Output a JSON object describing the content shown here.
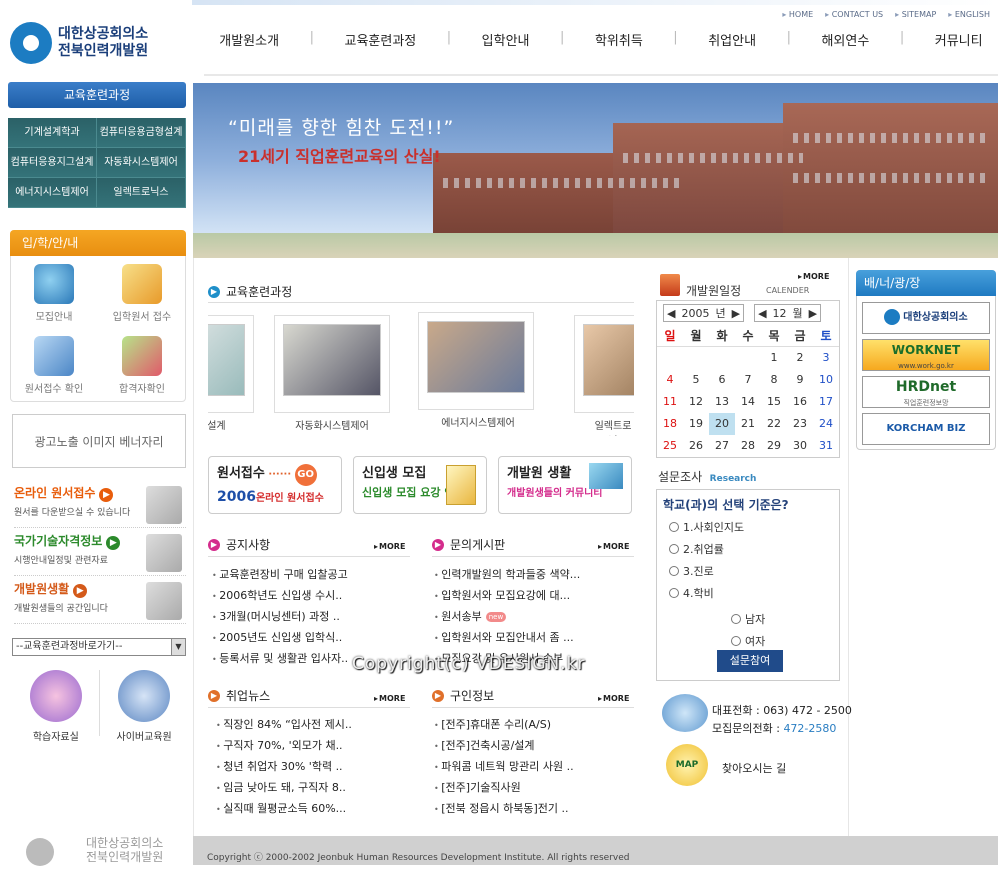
{
  "header": {
    "logo_line1": "대한상공회의소",
    "logo_line2": "전북인력개발원",
    "util_nav": [
      "HOME",
      "CONTACT US",
      "SITEMAP",
      "ENGLISH"
    ],
    "main_nav": [
      "개발원소개",
      "교육훈련과정",
      "입학안내",
      "학위취득",
      "취업안내",
      "해외연수",
      "커뮤니티"
    ]
  },
  "hero": {
    "line1": "“미래를 향한 힘찬 도전!!”",
    "line2": "21세기 직업훈련교육의 산실!"
  },
  "left": {
    "course_head": "교육훈련과정",
    "courses": [
      "기계설계학과",
      "컴퓨터응용금형설계",
      "컴퓨터응용지그설계",
      "자동화시스템제어",
      "에너지시스템제어",
      "일렉트로닉스"
    ],
    "admission_head": "입/학/안/내",
    "admission_items": [
      "모집안내",
      "입학원서 접수",
      "원서접수 확인",
      "합격자확인"
    ],
    "ad_banner": "광고노출 이미지 베너자리",
    "links": [
      {
        "title": "온라인 원서접수",
        "sub": "원서를 다운받으실 수 있습니다",
        "color": "#e85d0c"
      },
      {
        "title": "국가기술자격정보",
        "sub": "시행안내일정및 관련자료",
        "color": "#2c8a2c"
      },
      {
        "title": "개발원생활",
        "sub": "개발원생들의 공간입니다",
        "color": "#d45a1a"
      }
    ],
    "quick_select": "--교육훈련과정바로가기--",
    "circle_buttons": [
      "학습자료실",
      "사이버교육원"
    ],
    "footer_logo_line1": "대한상공회의소",
    "footer_logo_line2": "전북인력개발원"
  },
  "courses_section": {
    "title": "교육훈련과정",
    "photos": [
      "그설계",
      "자동화시스템제어",
      "에너지시스템제어",
      "일렉트로닉"
    ]
  },
  "banners": [
    {
      "t1": "원서접수",
      "go": "GO",
      "t2a": "2006",
      "t2b": "온라인 원서접수"
    },
    {
      "t1": "신입생 모집",
      "t2": "신입생 모집 요강 안내"
    },
    {
      "t1": "개발원 생활",
      "t2": "개발원생들의 커뮤니티"
    }
  ],
  "notice": {
    "title": "공지사항",
    "more": "MORE",
    "items": [
      "교육훈련장비 구매 입찰공고",
      "2006학년도 신입생 수시..",
      "3개월(머시닝센터) 과정 ..",
      "2005년도 신입생 입학식..",
      "등록서류 및 생활관 입사자.."
    ]
  },
  "qna": {
    "title": "문의게시판",
    "more": "MORE",
    "items": [
      "인력개발원의 학과들중 색약...",
      "입학원서와 모집요강에 대...",
      "원서송부",
      "입학원서와 모집안내서 좀 ...",
      "모집요강 및 우시원서 송부"
    ],
    "new_badge": "new"
  },
  "jobnews": {
    "title": "취업뉴스",
    "more": "MORE",
    "items": [
      "직장인 84% “입사전 제시..",
      "구직자 70%, '외모가 채..",
      "청년 취업자 30% '학력 ..",
      "임금 낮아도 돼, 구직자 8..",
      "실직때 월평균소득 60%..."
    ]
  },
  "jobs": {
    "title": "구인정보",
    "more": "MORE",
    "items": [
      "[전주]휴대폰 수리(A/S)",
      "[전주]건축시공/설계",
      "파워콤 네트웍 망관리 사원 ..",
      "[전주]기술직사원",
      "[전북 정읍시 하북동]전기 .."
    ]
  },
  "calendar": {
    "title": "개발원일정",
    "sub": "CALENDER",
    "more": "MORE",
    "year": "2005",
    "year_unit": "년",
    "month": "12",
    "month_unit": "월",
    "weekdays": [
      "일",
      "월",
      "화",
      "수",
      "목",
      "금",
      "토"
    ],
    "days": [
      "",
      "",
      "",
      "",
      "1",
      "2",
      "3",
      "4",
      "5",
      "6",
      "7",
      "8",
      "9",
      "10",
      "11",
      "12",
      "13",
      "14",
      "15",
      "16",
      "17",
      "18",
      "19",
      "20",
      "21",
      "22",
      "23",
      "24",
      "25",
      "26",
      "27",
      "28",
      "29",
      "30",
      "31"
    ],
    "today": "20"
  },
  "survey": {
    "title": "설문조사",
    "sub": "Research",
    "question": "학교(과)의 선택 기준은?",
    "options": [
      "1.사회인지도",
      "2.취업률",
      "3.진로",
      "4.학비"
    ],
    "gender": [
      "남자",
      "여자"
    ],
    "button": "설문참여"
  },
  "contact": {
    "rep_label": "대표전화",
    "rep_number": "063) 472 - 2500",
    "inq_label": "모집문의전화",
    "inq_number": "472-2580",
    "directions": "찾아오시는 길",
    "map_label": "MAP"
  },
  "plaza": {
    "title": "배/너/광/장",
    "links": [
      "대한상공회의소",
      "WORKNET",
      "HRDnet",
      "KORCHAM BIZ"
    ],
    "worknet_url": "www.work.go.kr",
    "hrdnet_sub": "직업훈련정보망"
  },
  "footer": {
    "copyright": "Copyright ⓒ 2000-2002 Jeonbuk Human Resources Development Institute. All rights reserved"
  },
  "watermark": "Copyright(c) VDESIGN.kr"
}
